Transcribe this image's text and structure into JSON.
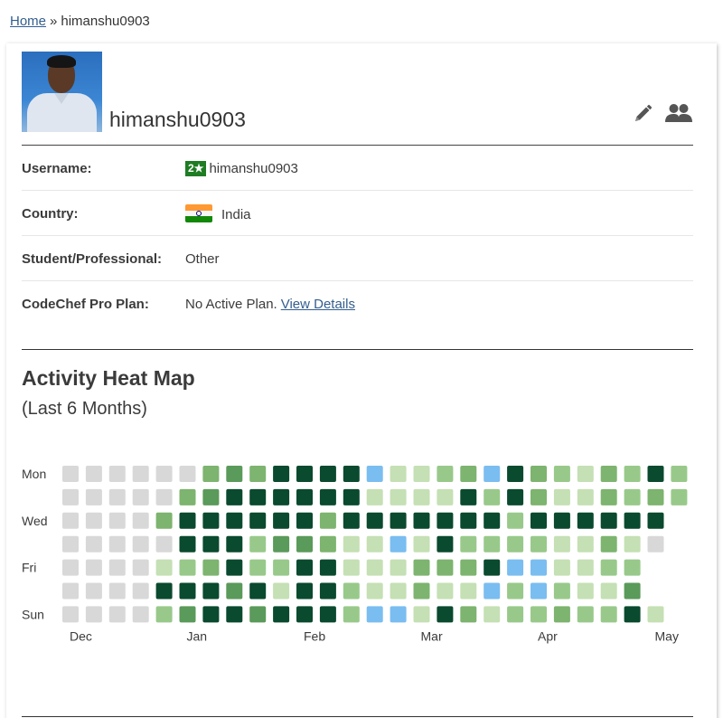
{
  "breadcrumb": {
    "home": "Home",
    "separator": "»",
    "current": "himanshu0903"
  },
  "profile": {
    "display_name": "himanshu0903",
    "icons": {
      "avatar": "user-photo",
      "edit": "pencil-icon",
      "friends": "people-icon"
    }
  },
  "info": {
    "username_label": "Username:",
    "rating_badge": "2★",
    "username": "himanshu0903",
    "country_label": "Country:",
    "country": "India",
    "student_label": "Student/Professional:",
    "student": "Other",
    "plan_label": "CodeChef Pro Plan:",
    "plan": "No Active Plan.",
    "plan_link": "View Details"
  },
  "heatmap": {
    "title": "Activity Heat Map",
    "subtitle": "(Last 6 Months)",
    "day_labels": [
      "Mon",
      "",
      "Wed",
      "",
      "Fri",
      "",
      "Sun"
    ],
    "month_labels": [
      {
        "label": "Dec",
        "week": 0
      },
      {
        "label": "Jan",
        "week": 5
      },
      {
        "label": "Feb",
        "week": 10
      },
      {
        "label": "Mar",
        "week": 15
      },
      {
        "label": "Apr",
        "week": 20
      },
      {
        "label": "May",
        "week": 25
      }
    ],
    "colors": [
      "#d8d8d8",
      "#c5e0b4",
      "#98c98a",
      "#7db46f",
      "#5a9a5a",
      "#0a4a2e",
      "#7abdf0"
    ],
    "grid": [
      [
        0,
        0,
        0,
        0,
        0,
        0,
        3,
        4,
        3,
        5,
        5,
        5,
        5,
        6,
        1,
        1,
        2,
        3,
        6,
        5,
        3,
        2,
        1,
        3,
        2,
        5,
        2
      ],
      [
        0,
        0,
        0,
        0,
        0,
        3,
        4,
        5,
        5,
        5,
        5,
        5,
        5,
        1,
        1,
        1,
        1,
        5,
        2,
        5,
        3,
        1,
        1,
        3,
        2,
        3,
        2
      ],
      [
        0,
        0,
        0,
        0,
        3,
        5,
        5,
        5,
        5,
        5,
        5,
        3,
        5,
        5,
        5,
        5,
        5,
        5,
        5,
        2,
        5,
        5,
        5,
        5,
        5,
        5
      ],
      [
        0,
        0,
        0,
        0,
        0,
        5,
        5,
        5,
        2,
        4,
        4,
        3,
        1,
        1,
        6,
        1,
        5,
        2,
        2,
        2,
        2,
        1,
        1,
        3,
        1,
        0
      ],
      [
        0,
        0,
        0,
        0,
        1,
        2,
        3,
        5,
        2,
        2,
        5,
        5,
        1,
        1,
        1,
        3,
        3,
        3,
        5,
        6,
        6,
        1,
        1,
        2,
        2
      ],
      [
        0,
        0,
        0,
        0,
        5,
        5,
        5,
        4,
        5,
        1,
        5,
        5,
        2,
        1,
        1,
        3,
        1,
        1,
        6,
        2,
        6,
        2,
        1,
        1,
        4
      ],
      [
        0,
        0,
        0,
        0,
        2,
        4,
        5,
        5,
        4,
        5,
        5,
        5,
        2,
        6,
        6,
        1,
        5,
        3,
        1,
        2,
        2,
        3,
        2,
        2,
        5,
        1
      ]
    ]
  }
}
